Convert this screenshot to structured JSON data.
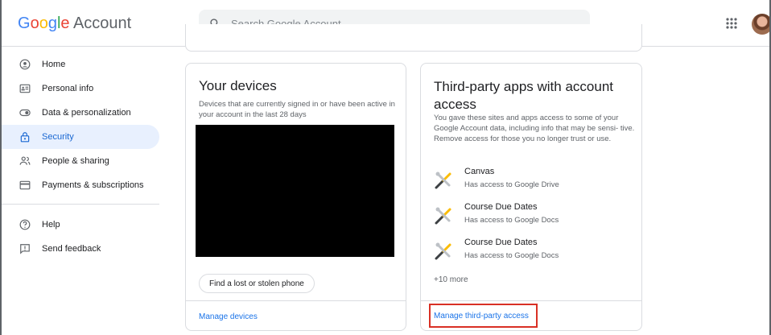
{
  "header": {
    "logo_google": "Google",
    "logo_account": " Account",
    "search_placeholder": "Search Google Account",
    "apps_icon": "apps-grid-icon",
    "avatar_icon": "user-avatar"
  },
  "sidebar": {
    "items": [
      {
        "label": "Home",
        "icon": "home-icon"
      },
      {
        "label": "Personal info",
        "icon": "id-card-icon"
      },
      {
        "label": "Data & personalization",
        "icon": "toggle-icon"
      },
      {
        "label": "Security",
        "icon": "lock-icon",
        "active": true
      },
      {
        "label": "People & sharing",
        "icon": "people-icon"
      },
      {
        "label": "Payments & subscriptions",
        "icon": "card-icon"
      }
    ],
    "secondary": [
      {
        "label": "Help",
        "icon": "help-icon"
      },
      {
        "label": "Send feedback",
        "icon": "feedback-icon"
      }
    ]
  },
  "devices": {
    "title": "Your devices",
    "description": "Devices that are currently signed in or have been active in your account in the last 28 days",
    "find_button": "Find a lost or stolen phone",
    "manage_link": "Manage devices"
  },
  "third_party": {
    "title": "Third-party apps with account access",
    "description": "You gave these sites and apps access to some of your Google Account data, including info that may be sensi- tive. Remove access for those you no longer trust or use.",
    "apps": [
      {
        "name": "Canvas",
        "access": "Has access to Google Drive"
      },
      {
        "name": "Course Due Dates",
        "access": "Has access to Google Docs"
      },
      {
        "name": "Course Due Dates",
        "access": "Has access to Google Docs"
      }
    ],
    "more": "+10 more",
    "manage_link": "Manage third-party access"
  },
  "colors": {
    "accent": "#1a73e8",
    "active_bg": "#e8f0fe",
    "highlight_box": "#d93025"
  }
}
